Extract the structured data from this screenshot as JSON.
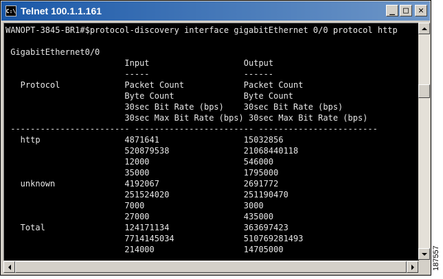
{
  "window": {
    "title": "Telnet 100.1.1.161",
    "icon_text": "C:\\",
    "minimize_glyph": "_",
    "maximize_glyph": "□",
    "close_glyph": "✕"
  },
  "console": {
    "lines": [
      "WANOPT-3845-BR1#$protocol-discovery interface gigabitEthernet 0/0 protocol http",
      "",
      " GigabitEthernet0/0",
      "                        Input                   Output",
      "                        -----                   ------",
      "   Protocol             Packet Count            Packet Count",
      "                        Byte Count              Byte Count",
      "                        30sec Bit Rate (bps)    30sec Bit Rate (bps)",
      "                        30sec Max Bit Rate (bps) 30sec Max Bit Rate (bps)",
      " ------------------------ ------------------------ ------------------------",
      "   http                 4871641                 15032856",
      "                        520879538               21068440118",
      "                        12000                   546000",
      "                        35000                   1795000",
      "   unknown              4192067                 2691772",
      "                        251524020               251190470",
      "                        7000                    3000",
      "                        27000                   435000",
      "   Total                124171134               363697423",
      "                        7714145034              510769281493",
      "                        214000                  14705000"
    ]
  },
  "figure_id": "187557"
}
